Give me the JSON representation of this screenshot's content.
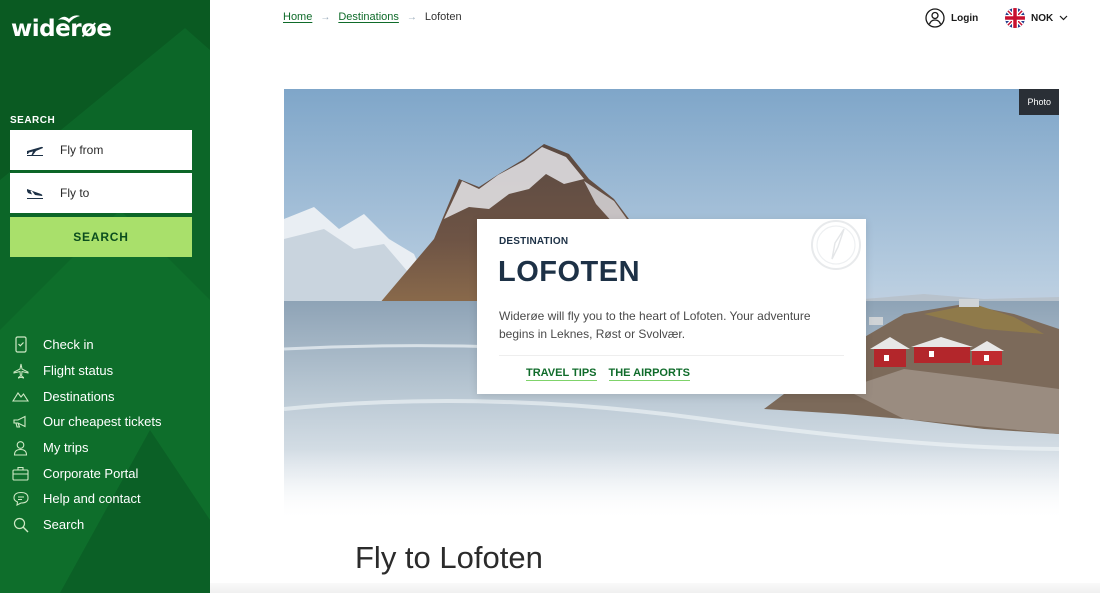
{
  "sidebar": {
    "logo": "widerøe",
    "search": {
      "heading": "SEARCH",
      "from_placeholder": "Fly from",
      "to_placeholder": "Fly to",
      "button_label": "SEARCH"
    },
    "nav": [
      {
        "label": "Check in",
        "icon": "phone-checkin-icon"
      },
      {
        "label": "Flight status",
        "icon": "airplane-icon"
      },
      {
        "label": "Destinations",
        "icon": "mountains-icon"
      },
      {
        "label": "Our cheapest tickets",
        "icon": "megaphone-icon"
      },
      {
        "label": "My trips",
        "icon": "person-icon"
      },
      {
        "label": "Corporate Portal",
        "icon": "briefcase-icon"
      },
      {
        "label": "Help and contact",
        "icon": "chat-icon"
      },
      {
        "label": "Search",
        "icon": "search-icon"
      }
    ]
  },
  "breadcrumb": {
    "items": [
      "Home",
      "Destinations"
    ],
    "current": "Lofoten"
  },
  "header": {
    "login_label": "Login",
    "currency": "NOK"
  },
  "hero": {
    "photo_badge": "Photo",
    "card": {
      "label": "DESTINATION",
      "title": "LOFOTEN",
      "text": "Widerøe will fly you to the heart of Lofoten. Your adventure begins in Leknes, Røst or Svolvær.",
      "links": [
        "TRAVEL TIPS",
        "THE AIRPORTS"
      ]
    }
  },
  "page_heading": "Fly to Lofoten",
  "colors": {
    "sidebar_green": "#0a5a22",
    "search_button": "#a9e06b",
    "link_green": "#0f6b2a",
    "title_navy": "#1d3146"
  }
}
